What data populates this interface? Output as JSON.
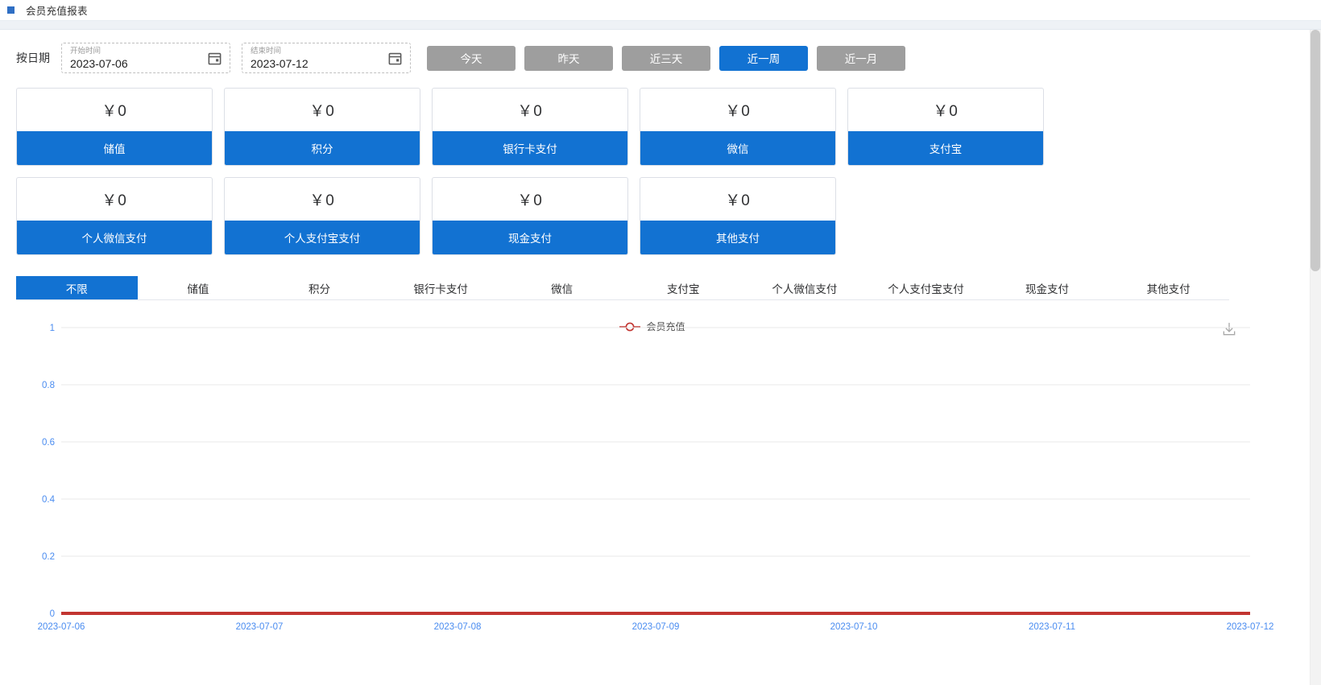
{
  "titlebar": {
    "tab_title": "会员充值报表",
    "marker_color": "#2f6fc4"
  },
  "filter": {
    "label": "按日期",
    "start": {
      "name": "开始时间",
      "value": "2023-07-06",
      "icon": "calendar-icon"
    },
    "end": {
      "name": "结束时间",
      "value": "2023-07-12",
      "icon": "calendar-icon"
    },
    "quick_buttons": [
      {
        "label": "今天",
        "active": false
      },
      {
        "label": "昨天",
        "active": false
      },
      {
        "label": "近三天",
        "active": false
      },
      {
        "label": "近一周",
        "active": true
      },
      {
        "label": "近一月",
        "active": false
      }
    ],
    "active_color": "#1272d2",
    "inactive_color": "#9e9e9e"
  },
  "cards": [
    {
      "value": "￥0",
      "label": "储值"
    },
    {
      "value": "￥0",
      "label": "积分"
    },
    {
      "value": "￥0",
      "label": "银行卡支付"
    },
    {
      "value": "￥0",
      "label": "微信"
    },
    {
      "value": "￥0",
      "label": "支付宝"
    },
    {
      "value": "￥0",
      "label": "个人微信支付"
    },
    {
      "value": "￥0",
      "label": "个人支付宝支付"
    },
    {
      "value": "￥0",
      "label": "现金支付"
    },
    {
      "value": "￥0",
      "label": "其他支付"
    }
  ],
  "tabs": [
    {
      "label": "不限",
      "active": true
    },
    {
      "label": "储值",
      "active": false
    },
    {
      "label": "积分",
      "active": false
    },
    {
      "label": "银行卡支付",
      "active": false
    },
    {
      "label": "微信",
      "active": false
    },
    {
      "label": "支付宝",
      "active": false
    },
    {
      "label": "个人微信支付",
      "active": false
    },
    {
      "label": "个人支付宝支付",
      "active": false
    },
    {
      "label": "现金支付",
      "active": false
    },
    {
      "label": "其他支付",
      "active": false
    }
  ],
  "chart_toolbar": {
    "download_icon": "download-icon"
  },
  "chart_data": {
    "type": "line",
    "title": "",
    "legend": [
      "会员充值"
    ],
    "legend_position": "top-center",
    "series": [
      {
        "name": "会员充值",
        "color": "#c23531",
        "values": [
          0,
          0,
          0,
          0,
          0,
          0,
          0
        ]
      }
    ],
    "categories": [
      "2023-07-06",
      "2023-07-07",
      "2023-07-08",
      "2023-07-09",
      "2023-07-10",
      "2023-07-11",
      "2023-07-12"
    ],
    "xlabel": "",
    "ylabel": "",
    "ylim": [
      0,
      1
    ],
    "yticks": [
      "0",
      "0.2",
      "0.4",
      "0.6",
      "0.8",
      "1"
    ],
    "grid": true,
    "axis_label_color": "#4a8cf0"
  }
}
